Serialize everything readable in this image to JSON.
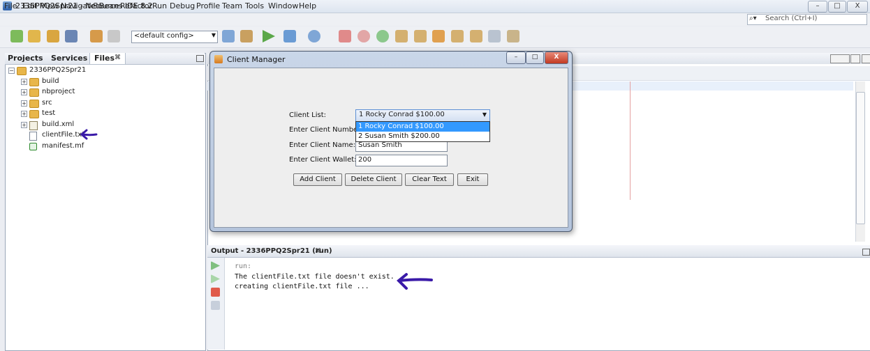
{
  "window": {
    "title": "2336PPQ2Spr21 - NetBeans IDE 8.2",
    "minimize": "–",
    "maximize": "□",
    "close": "X"
  },
  "menubar": {
    "items": [
      "File",
      "Edit",
      "View",
      "Navigate",
      "Source",
      "Refactor",
      "Run",
      "Debug",
      "Profile",
      "Team",
      "Tools",
      "Window",
      "Help"
    ],
    "search_placeholder": "Search (Ctrl+I)"
  },
  "toolbar": {
    "config": "<default config>"
  },
  "left_panel": {
    "tabs": [
      "Projects",
      "Services",
      "Files"
    ],
    "files_close": "⌘",
    "tree": [
      {
        "label": "2336PPQ2Spr21",
        "type": "folder",
        "depth": 0,
        "expander": "−"
      },
      {
        "label": "build",
        "type": "folder",
        "depth": 1,
        "expander": "+"
      },
      {
        "label": "nbproject",
        "type": "folder",
        "depth": 1,
        "expander": "+"
      },
      {
        "label": "src",
        "type": "folder",
        "depth": 1,
        "expander": "+"
      },
      {
        "label": "test",
        "type": "folder",
        "depth": 1,
        "expander": "+"
      },
      {
        "label": "build.xml",
        "type": "xml",
        "depth": 1,
        "expander": "+"
      },
      {
        "label": "clientFile.txt",
        "type": "file",
        "depth": 1,
        "expander": ""
      },
      {
        "label": "manifest.mf",
        "type": "mf",
        "depth": 1,
        "expander": ""
      }
    ]
  },
  "dialog": {
    "title": "Client Manager",
    "labels": {
      "client_list": "Client List:",
      "client_number": "Enter Client Number:",
      "client_name": "Enter Client Name:",
      "client_wallet": "Enter Client Wallet:"
    },
    "selected": "1  Rocky Conrad  $100.00",
    "options": [
      "1  Rocky Conrad  $100.00",
      "2  Susan Smith  $200.00"
    ],
    "client_name_value": "Susan Smith",
    "client_wallet_value": "200",
    "buttons": {
      "add": "Add Client",
      "delete": "Delete Client",
      "clear": "Clear Text",
      "exit": "Exit"
    }
  },
  "output": {
    "title": "Output - 2336PPQ2Spr21 (run)",
    "close": "⌘",
    "lines": [
      "run:",
      "The clientFile.txt file doesn't exist.",
      "creating clientFile.txt file ..."
    ]
  },
  "colors": {
    "annotation_arrow": "#3a1aa8",
    "dropdown_highlight": "#3399ff"
  }
}
